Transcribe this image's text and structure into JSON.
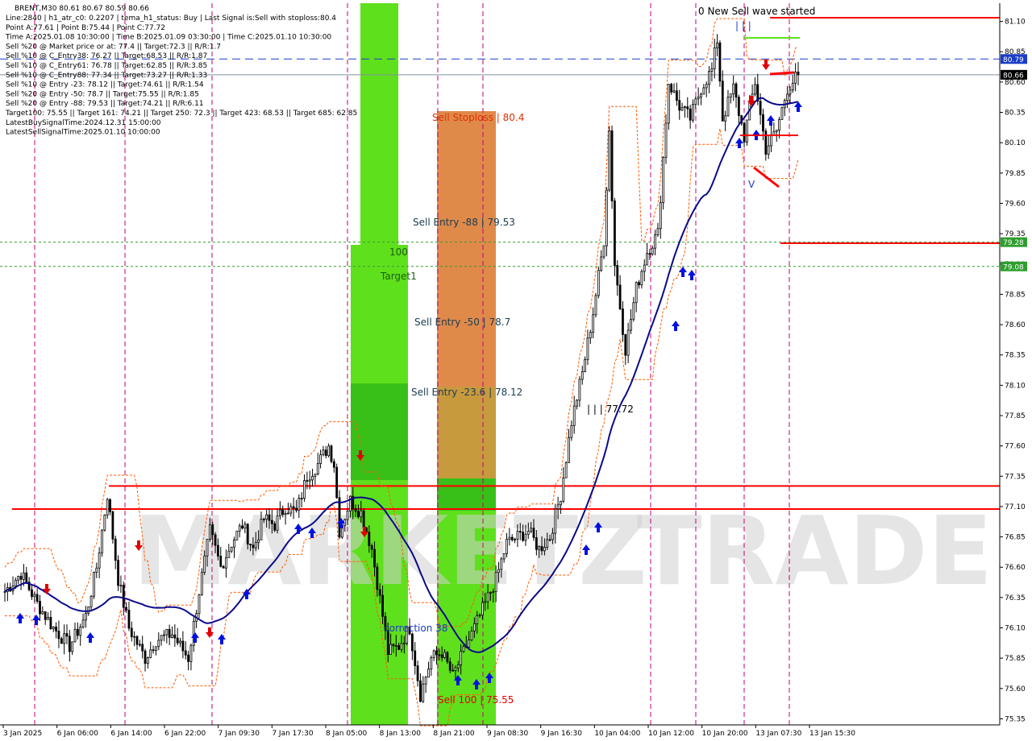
{
  "header": {
    "symbol_line": "BRENT,M30  80.61 80.67 80.59 80.66",
    "info_lines": [
      "Line:2840  |  h1_atr_c0: 0.2207  |  tema_h1_status: Buy  |  Last Signal is:Sell with stoploss:80.4",
      "Point A:77.61  |  Point B:75.44  |  Point C:77.72",
      "Time A:2025.01.08 10:30:00  |  Time B:2025.01.09 03:30:00  |  Time C:2025.01.10 10:30:00",
      "Sell %20 @ Market price or at: 77.4  ||  Target:72.3  ||  R/R:1.7",
      "Sell %10 @ C_Entry38: 76.27  ||  Target:68.53  ||  R/R:1.87",
      "Sell %10 @ C_Entry61: 76.78  ||  Target:62.85  ||  R/R:3.85",
      "Sell %10 @ C_Entry88: 77.34  ||  Target:73.27  ||  R/R:1.33",
      "Sell %10 @ Entry -23: 78.12  ||  Target:74.61  ||  R/R:1.54",
      "Sell %20 @ Entry -50: 78.7  ||  Target:75.55  ||  R/R:1.85",
      "Sell %20 @ Entry -88: 79.53  ||  Target:74.21  ||  R/R:6.11",
      "Target100: 75.55  ||  Target 161: 74.21  ||  Target 250: 72.3  ||  Target 423: 68.53  ||  Target 685: 62.85",
      "LatestBuySignalTime:2024.12.31 15:00:00",
      "LatestSellSignalTime:2025.01.10 10:00:00"
    ]
  },
  "annotations": {
    "new_wave": "0 New Sell wave started",
    "sell_stoploss": "Sell Stoploss | 80.4",
    "sell_entry_88": "Sell Entry -88 | 79.53",
    "label_100": "100",
    "target1": "Target1",
    "sell_entry_50": "Sell Entry -50 | 78.7",
    "sell_entry_23": "Sell Entry -23.6 | 78.12",
    "point_c": "| | | 77.72",
    "correction": "correction 38",
    "sell_100": "Sell 100 | 75.55",
    "wave_marks": "| | |",
    "v_mark": "V"
  },
  "watermark": {
    "left": "MARKETZ",
    "right": "TRADE"
  },
  "price_tags": [
    {
      "value": "80.79",
      "color": "#1a3cc8"
    },
    {
      "value": "80.66",
      "color": "#000000"
    },
    {
      "value": "79.28",
      "color": "#2e9e2e"
    },
    {
      "value": "79.08",
      "color": "#2e9e2e"
    }
  ],
  "colors": {
    "candle": "#000000",
    "ma": "#0a0a8a",
    "envelope": "#ff5a00",
    "resistance": "#ff0000",
    "green_zone": "#5fe01c",
    "orange_zone": "#e08040",
    "vline": "#c0007a",
    "buy_arrow": "#0010e0",
    "sell_arrow": "#e00000",
    "hline_blue": "#1a3cc8",
    "hline_green": "#2e9e2e"
  },
  "chart_data": {
    "type": "candlestick",
    "symbol": "BRENT",
    "timeframe": "M30",
    "ylim": [
      75.3,
      81.25
    ],
    "y_ticks": [
      "81.10",
      "80.85",
      "80.60",
      "80.35",
      "80.10",
      "79.85",
      "79.60",
      "79.35",
      "79.10",
      "78.85",
      "78.60",
      "78.35",
      "78.10",
      "77.85",
      "77.60",
      "77.35",
      "77.10",
      "76.85",
      "76.60",
      "76.35",
      "76.10",
      "75.85",
      "75.60",
      "75.35"
    ],
    "x_ticks": [
      "3 Jan 2025",
      "6 Jan 06:00",
      "6 Jan 14:00",
      "6 Jan 22:00",
      "7 Jan 09:30",
      "7 Jan 17:30",
      "8 Jan 05:00",
      "8 Jan 13:00",
      "8 Jan 21:00",
      "9 Jan 08:30",
      "9 Jan 16:30",
      "10 Jan 04:00",
      "10 Jan 12:00",
      "10 Jan 20:00",
      "13 Jan 07:30",
      "13 Jan 15:30"
    ],
    "horizontal_levels": [
      {
        "price": 80.79,
        "style": "dashed",
        "color": "#1a3cc8"
      },
      {
        "price": 80.66,
        "style": "solid",
        "color": "#8090a0"
      },
      {
        "price": 79.28,
        "style": "dotted",
        "color": "#2e9e2e"
      },
      {
        "price": 79.08,
        "style": "dotted",
        "color": "#2e9e2e"
      },
      {
        "price": 77.27,
        "style": "solid",
        "color": "#ff0000"
      },
      {
        "price": 77.08,
        "style": "solid",
        "color": "#ff0000"
      }
    ],
    "last": {
      "open": 80.61,
      "high": 80.67,
      "low": 80.59,
      "close": 80.66
    },
    "key_points": {
      "A": 77.61,
      "B": 75.44,
      "C": 77.72,
      "stoploss": 80.4
    },
    "close_path": [
      [
        0,
        76.4
      ],
      [
        3,
        76.55
      ],
      [
        6,
        76.3
      ],
      [
        9,
        76.1
      ],
      [
        12,
        75.95
      ],
      [
        15,
        76.2
      ],
      [
        17,
        76.6
      ],
      [
        19,
        77.2
      ],
      [
        21,
        76.5
      ],
      [
        23,
        76.1
      ],
      [
        26,
        75.85
      ],
      [
        28,
        76.0
      ],
      [
        31,
        76.05
      ],
      [
        34,
        75.85
      ],
      [
        36,
        76.4
      ],
      [
        38,
        76.9
      ],
      [
        40,
        76.6
      ],
      [
        42,
        76.8
      ],
      [
        44,
        76.95
      ],
      [
        46,
        76.75
      ],
      [
        48,
        77.0
      ],
      [
        50,
        76.95
      ],
      [
        52,
        77.1
      ],
      [
        54,
        77.05
      ],
      [
        56,
        77.35
      ],
      [
        58,
        77.45
      ],
      [
        60,
        77.6
      ],
      [
        61,
        77.45
      ],
      [
        62,
        76.9
      ],
      [
        64,
        77.15
      ],
      [
        66,
        77.05
      ],
      [
        68,
        76.75
      ],
      [
        70,
        76.2
      ],
      [
        71,
        75.9
      ],
      [
        73,
        75.95
      ],
      [
        75,
        76.1
      ],
      [
        77,
        75.55
      ],
      [
        79,
        75.85
      ],
      [
        81,
        75.9
      ],
      [
        83,
        75.7
      ],
      [
        85,
        75.9
      ],
      [
        87,
        76.1
      ],
      [
        89,
        76.3
      ],
      [
        91,
        76.5
      ],
      [
        93,
        76.8
      ],
      [
        95,
        76.85
      ],
      [
        97,
        76.9
      ],
      [
        99,
        76.75
      ],
      [
        101,
        76.85
      ],
      [
        103,
        77.2
      ],
      [
        105,
        77.8
      ],
      [
        107,
        78.2
      ],
      [
        109,
        78.7
      ],
      [
        111,
        79.3
      ],
      [
        112,
        80.2
      ],
      [
        113,
        79.1
      ],
      [
        115,
        78.4
      ],
      [
        117,
        78.9
      ],
      [
        119,
        79.2
      ],
      [
        121,
        79.35
      ],
      [
        123,
        80.6
      ],
      [
        125,
        80.4
      ],
      [
        127,
        80.3
      ],
      [
        129,
        80.55
      ],
      [
        131,
        80.7
      ],
      [
        132,
        80.95
      ],
      [
        133,
        80.3
      ],
      [
        135,
        80.55
      ],
      [
        137,
        80.15
      ],
      [
        139,
        80.6
      ],
      [
        141,
        80.05
      ],
      [
        143,
        80.2
      ],
      [
        145,
        80.55
      ],
      [
        147,
        80.66
      ]
    ]
  }
}
